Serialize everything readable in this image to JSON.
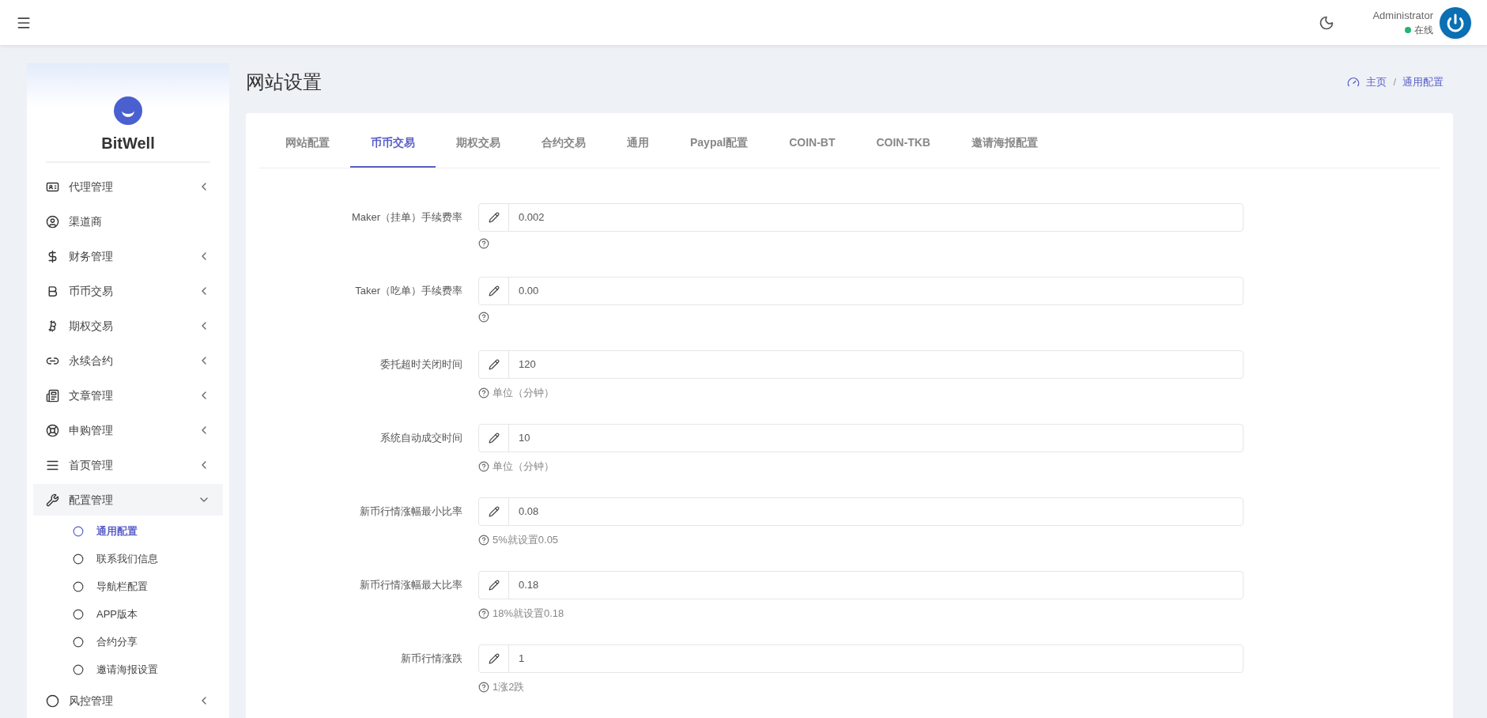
{
  "header": {
    "user_name": "Administrator",
    "status": "在线"
  },
  "sidebar": {
    "brand": "BitWell",
    "items": [
      {
        "label": "代理管理",
        "expandable": true,
        "expanded": false
      },
      {
        "label": "渠道商",
        "expandable": false
      },
      {
        "label": "财务管理",
        "expandable": true,
        "expanded": false
      },
      {
        "label": "币币交易",
        "expandable": true,
        "expanded": false
      },
      {
        "label": "期权交易",
        "expandable": true,
        "expanded": false
      },
      {
        "label": "永续合约",
        "expandable": true,
        "expanded": false
      },
      {
        "label": "文章管理",
        "expandable": true,
        "expanded": false
      },
      {
        "label": "申购管理",
        "expandable": true,
        "expanded": false
      },
      {
        "label": "首页管理",
        "expandable": true,
        "expanded": false
      },
      {
        "label": "配置管理",
        "expandable": true,
        "expanded": true,
        "children": [
          {
            "label": "通用配置",
            "selected": true
          },
          {
            "label": "联系我们信息",
            "selected": false
          },
          {
            "label": "导航栏配置",
            "selected": false
          },
          {
            "label": "APP版本",
            "selected": false
          },
          {
            "label": "合约分享",
            "selected": false
          },
          {
            "label": "邀请海报设置",
            "selected": false
          }
        ]
      },
      {
        "label": "风控管理",
        "expandable": true,
        "expanded": false
      }
    ]
  },
  "page": {
    "title": "网站设置",
    "breadcrumb": [
      "主页",
      "通用配置"
    ],
    "breadcrumb_separator": "/"
  },
  "tabs": [
    {
      "label": "网站配置",
      "selected": false
    },
    {
      "label": "币币交易",
      "selected": true
    },
    {
      "label": "期权交易",
      "selected": false
    },
    {
      "label": "合约交易",
      "selected": false
    },
    {
      "label": "通用",
      "selected": false
    },
    {
      "label": "Paypal配置",
      "selected": false
    },
    {
      "label": "COIN-BT",
      "selected": false
    },
    {
      "label": "COIN-TKB",
      "selected": false
    },
    {
      "label": "邀请海报配置",
      "selected": false
    }
  ],
  "fields": [
    {
      "label": "Maker（挂单）手续费率",
      "value": "0.002"
    },
    {
      "label": "Taker（吃单）手续费率",
      "value": "0.00"
    },
    {
      "label": "委托超时关闭时间",
      "value": "120",
      "help": "单位（分钟）"
    },
    {
      "label": "系统自动成交时间",
      "value": "10",
      "help": "单位（分钟）"
    },
    {
      "label": "新币行情涨幅最小比率",
      "value": "0.08",
      "help": "5%就设置0.05"
    },
    {
      "label": "新币行情涨幅最大比率",
      "value": "0.18",
      "help": "18%就设置0.18"
    },
    {
      "label": "新币行情涨跌",
      "value": "1",
      "help": "1涨2跌"
    }
  ]
}
